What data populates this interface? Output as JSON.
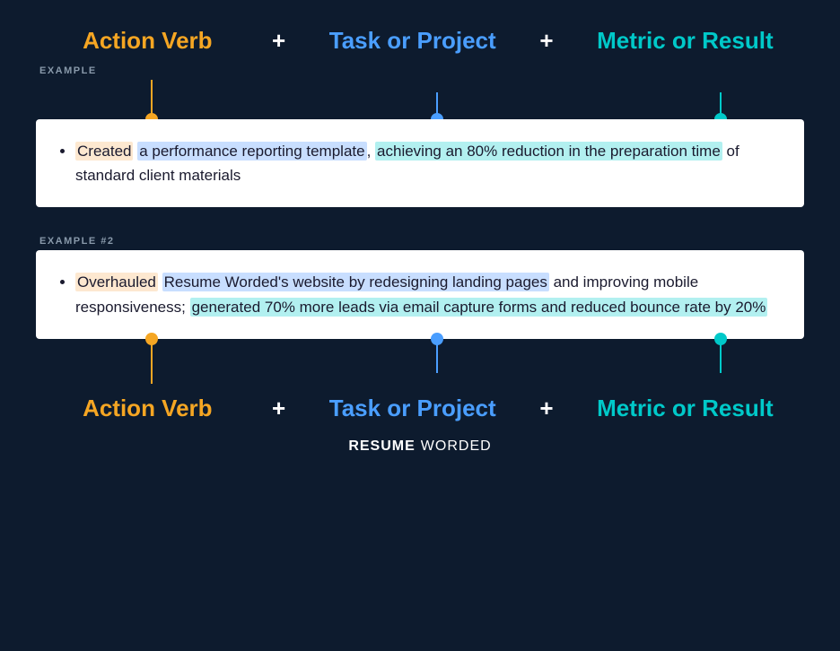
{
  "top_labels": {
    "action_verb": "Action Verb",
    "plus1": "+",
    "task_or_project": "Task or Project",
    "plus2": "+",
    "metric_or_result": "Metric or Result"
  },
  "example1": {
    "label": "EXAMPLE",
    "bullet": {
      "action_part": "Created",
      "task_part": "a performance reporting template",
      "metric_part": "achieving an 80% reduction in the preparation time",
      "rest": " of standard client materials"
    }
  },
  "example2": {
    "label": "EXAMPLE #2",
    "bullet": {
      "action_part": "Overhauled",
      "task_part": "Resume Worded's website by redesigning landing pages",
      "metric_part": "generated 70% more leads via email capture forms and reduced bounce rate by 20%",
      "middle": " and improving mobile responsiveness; "
    }
  },
  "bottom_labels": {
    "action_verb": "Action Verb",
    "plus1": "+",
    "task_or_project": "Task or Project",
    "plus2": "+",
    "metric_or_result": "Metric or Result"
  },
  "branding": {
    "resume": "RESUME",
    "worded": "WORDED"
  }
}
